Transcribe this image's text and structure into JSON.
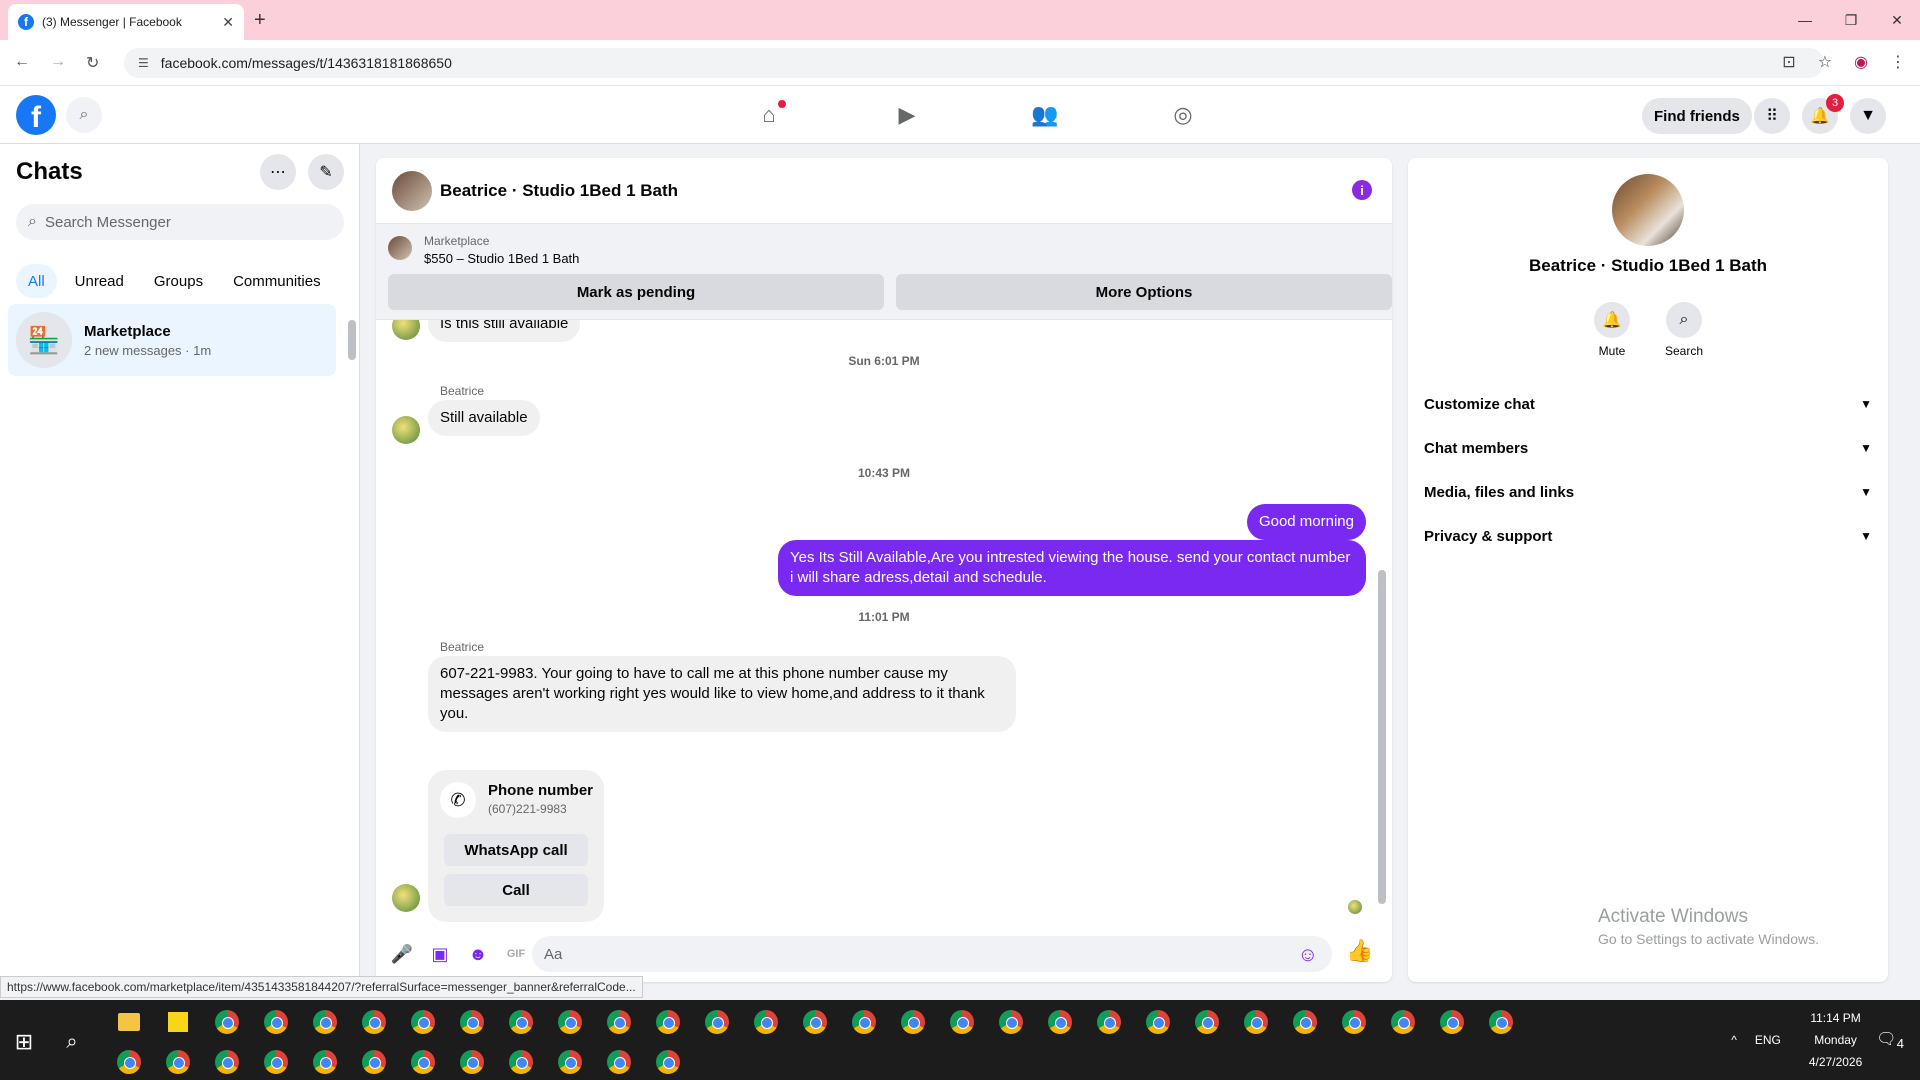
{
  "browser": {
    "tab_title": "(3) Messenger | Facebook",
    "url": "facebook.com/messages/t/1436318181868650",
    "status_url": "https://www.facebook.com/marketplace/item/4351433581844207/?referralSurface=messenger_banner&referralCode..."
  },
  "header": {
    "find_friends": "Find friends",
    "notif_count": "3"
  },
  "left": {
    "title": "Chats",
    "search_placeholder": "Search Messenger",
    "filters": [
      "All",
      "Unread",
      "Groups",
      "Communities"
    ],
    "chat": {
      "name": "Marketplace",
      "sub": "2 new messages · 1m"
    }
  },
  "conversation": {
    "title": "Beatrice · Studio 1Bed 1 Bath",
    "marketplace_label": "Marketplace",
    "marketplace_item": "$550 – Studio 1Bed 1 Bath",
    "mark_pending": "Mark as pending",
    "more_options": "More Options",
    "messages": {
      "m1": "Is this still available",
      "ts1": "Sun 6:01 PM",
      "sender1": "Beatrice",
      "m2": "Still available",
      "ts2": "10:43 PM",
      "m3": "Good morning",
      "m4": "Yes Its Still Available,Are you intrested viewing the house. send your contact number i will share adress,detail and schedule.",
      "ts3": "11:01 PM",
      "sender2": "Beatrice",
      "m5": "607-221-9983. Your going to have to call me at this phone number  cause my messages aren't working right  yes would like to view home,and address to it thank you."
    },
    "phone_card": {
      "title": "Phone number",
      "number": "(607)221-9983",
      "whatsapp": "WhatsApp call",
      "call": "Call"
    },
    "composer_placeholder": "Aa"
  },
  "right": {
    "name": "Beatrice · Studio 1Bed 1 Bath",
    "mute": "Mute",
    "search": "Search",
    "sections": [
      "Customize chat",
      "Chat members",
      "Media, files and links",
      "Privacy & support"
    ]
  },
  "watermark": {
    "line1": "Activate Windows",
    "line2": "Go to Settings to activate Windows."
  },
  "taskbar": {
    "time": "11:14 PM",
    "day": "Monday",
    "date": "4/27/2026",
    "lang": "ENG",
    "notif": "4"
  }
}
